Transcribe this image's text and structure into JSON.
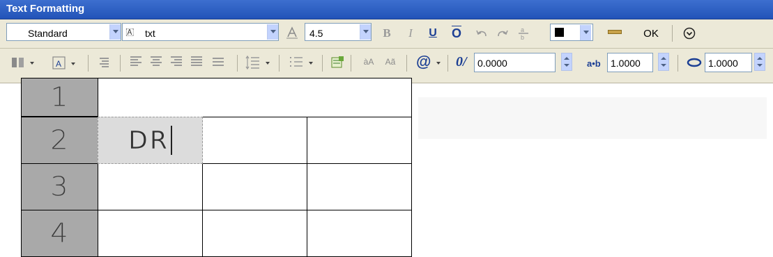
{
  "window": {
    "title": "Text Formatting"
  },
  "toolbar": {
    "style": {
      "value": "Standard"
    },
    "font": {
      "value": "txt"
    },
    "height": {
      "value": "4.5"
    },
    "bold_label": "B",
    "italic_label": "I",
    "underline_label": "U",
    "overline_label": "O",
    "ok_label": "OK",
    "color": "#000000"
  },
  "format_bar": {
    "oblique_label": "0/",
    "oblique_value": "0.0000",
    "tracking_label": "a•b",
    "tracking_value": "1.0000",
    "width_value": "1.0000",
    "uppercase_label": "àA",
    "lowercase_label": "Aã"
  },
  "table": {
    "row_headers": [
      "1",
      "2",
      "3",
      "4"
    ],
    "active_cell_text": "DR"
  }
}
